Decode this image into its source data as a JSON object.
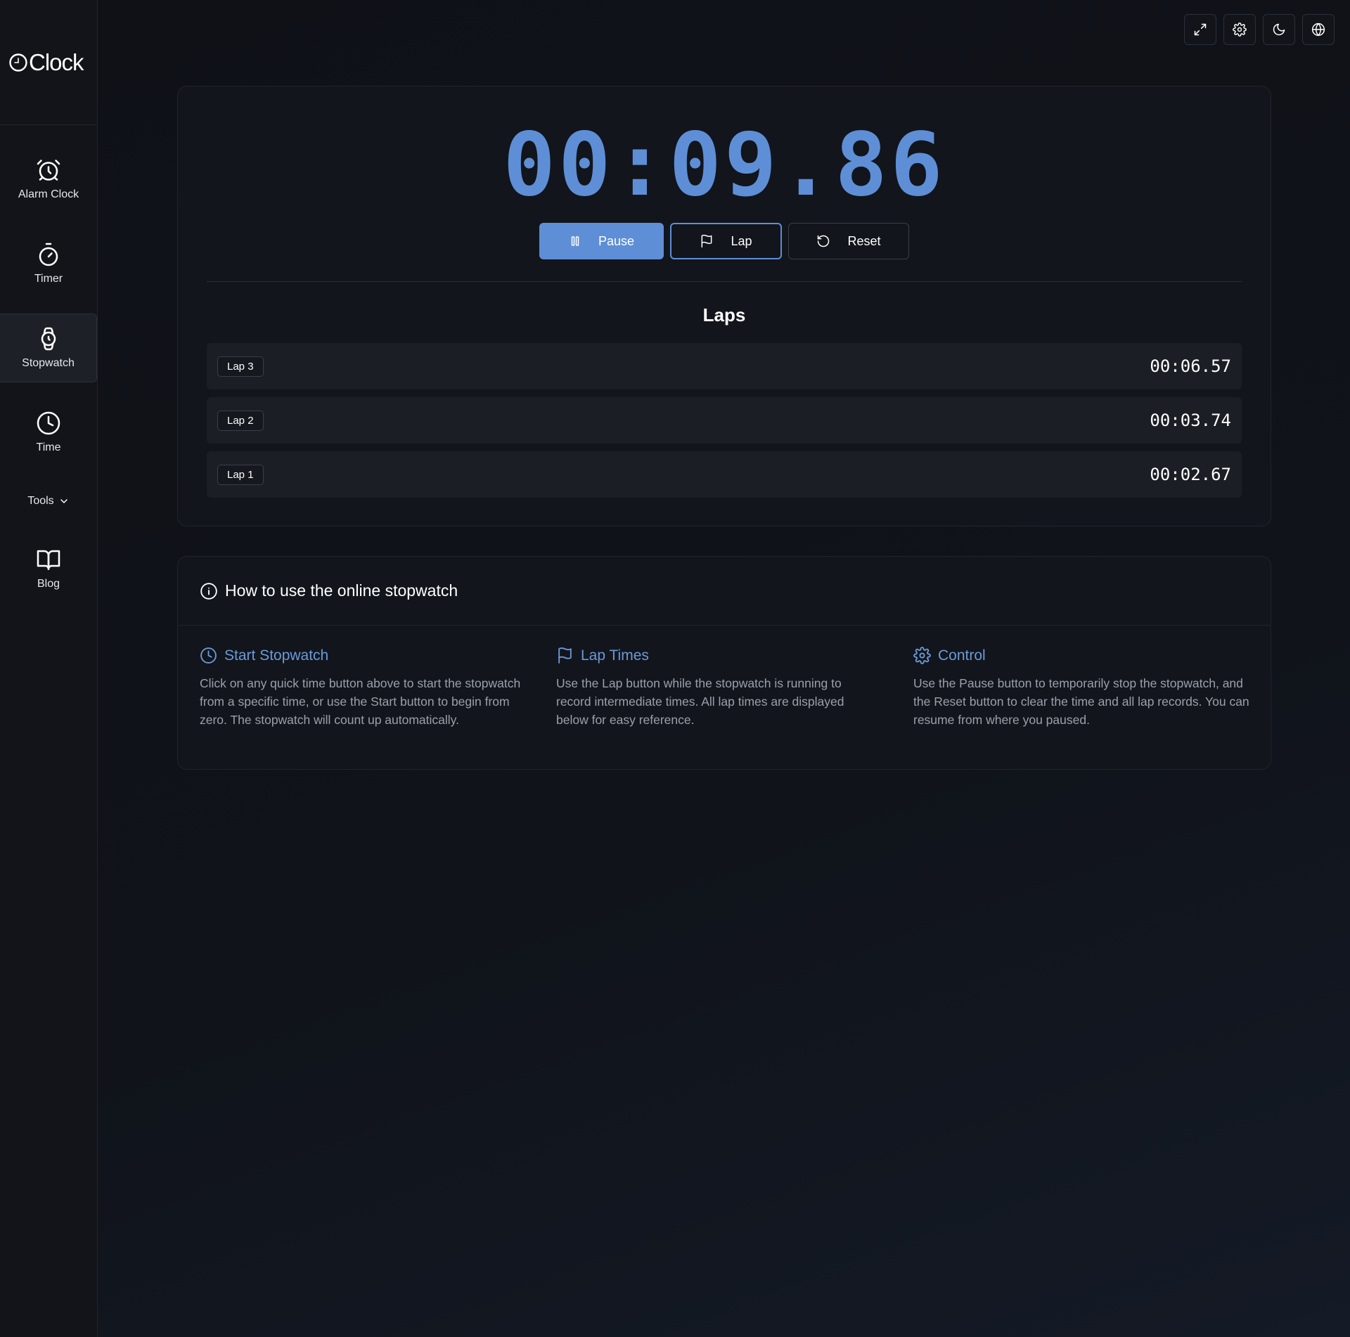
{
  "app": {
    "logo_text": "Clock"
  },
  "sidebar": {
    "items": [
      {
        "label": "Alarm Clock",
        "icon": "alarm-clock-icon"
      },
      {
        "label": "Timer",
        "icon": "timer-icon"
      },
      {
        "label": "Stopwatch",
        "icon": "stopwatch-icon",
        "active": true
      },
      {
        "label": "Time",
        "icon": "clock-icon"
      }
    ],
    "tools_label": "Tools",
    "blog_label": "Blog"
  },
  "topbar": {
    "icons": [
      "fullscreen-icon",
      "settings-icon",
      "dark-mode-icon",
      "language-icon"
    ]
  },
  "stopwatch": {
    "display": "00:09.86",
    "pause_label": "Pause",
    "lap_label": "Lap",
    "reset_label": "Reset",
    "accent_color": "#5e8fd6"
  },
  "laps": {
    "title": "Laps",
    "items": [
      {
        "label": "Lap 3",
        "time": "00:06.57"
      },
      {
        "label": "Lap 2",
        "time": "00:03.74"
      },
      {
        "label": "Lap 1",
        "time": "00:02.67"
      }
    ]
  },
  "info": {
    "title": "How to use the online stopwatch",
    "columns": [
      {
        "title": "Start Stopwatch",
        "icon": "clock-icon",
        "text": "Click on any quick time button above to start the stopwatch from a specific time, or use the Start button to begin from zero. The stopwatch will count up automatically."
      },
      {
        "title": "Lap Times",
        "icon": "flag-icon",
        "text": "Use the Lap button while the stopwatch is running to record intermediate times. All lap times are displayed below for easy reference."
      },
      {
        "title": "Control",
        "icon": "gear-icon",
        "text": "Use the Pause button to temporarily stop the stopwatch, and the Reset button to clear the time and all lap records. You can resume from where you paused."
      }
    ]
  }
}
